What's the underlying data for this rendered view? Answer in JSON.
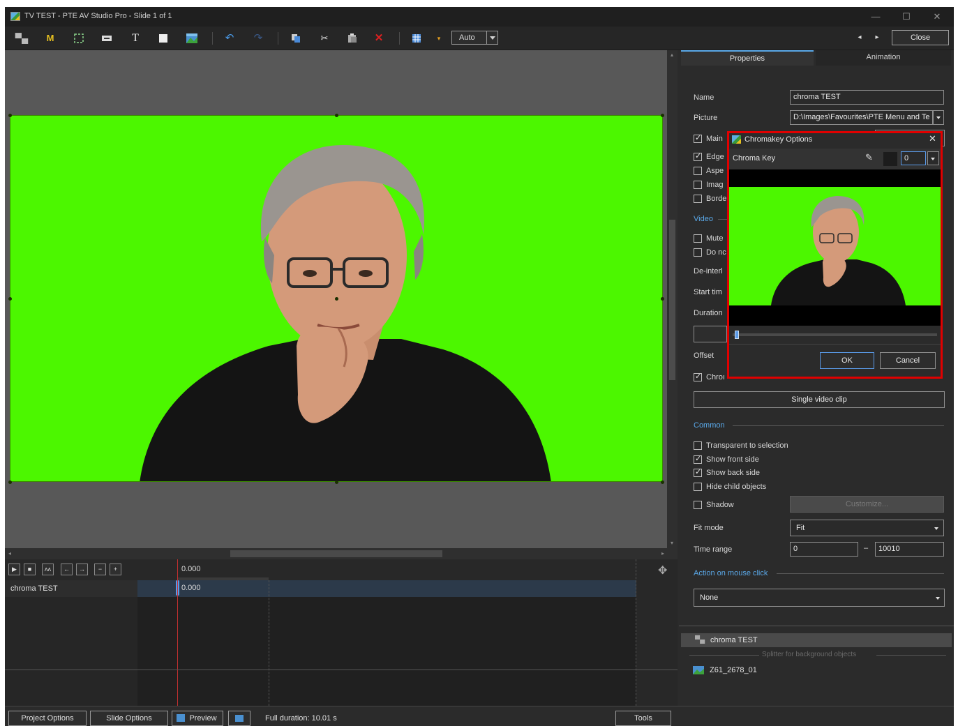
{
  "window": {
    "title": "TV TEST - PTE AV Studio Pro - Slide 1 of 1"
  },
  "toolbar": {
    "zoom_value": "Auto",
    "close_label": "Close",
    "icons": [
      "video-icon",
      "mask-icon",
      "frame-icon",
      "button-icon",
      "text-icon",
      "rectangle-icon",
      "image-icon",
      "undo-icon",
      "redo-icon",
      "copy-icon",
      "cut-icon",
      "paste-icon",
      "delete-icon",
      "grid-icon",
      "grid-dropdown-icon"
    ]
  },
  "timeline": {
    "position": "0.000",
    "object_name": "chroma TEST",
    "clip_start": "0.000",
    "buttons": [
      "▶",
      "■",
      "ʌʌ",
      "←",
      "→",
      "−",
      "+"
    ]
  },
  "panel": {
    "tabs": [
      "Properties",
      "Animation"
    ],
    "name_label": "Name",
    "name_value": "chroma TEST",
    "picture_label": "Picture",
    "picture_value": "D:\\Images\\Favourites\\PTE Menu and Te",
    "main_label": "Main",
    "edge_label": "Edge",
    "aspect_label": "Aspe",
    "image_label": "Imag",
    "border_label": "Borde",
    "video_section": "Video",
    "mute_label": "Mute",
    "donot_label": "Do nc",
    "deinterlace_label": "De-interl",
    "start_time_label": "Start tim",
    "duration_label": "Duration",
    "offset_label": "Offset",
    "chroma_label": "Chroı",
    "single_clip_button": "Single video clip",
    "common_section": "Common",
    "transparent_label": "Transparent to selection",
    "show_front_label": "Show front side",
    "show_back_label": "Show back side",
    "hide_child_label": "Hide child objects",
    "shadow_label": "Shadow",
    "customize_button": "Customize...",
    "fit_mode_label": "Fit mode",
    "fit_mode_value": "Fit",
    "time_range_label": "Time range",
    "time_range_from": "0",
    "time_range_dash": "–",
    "time_range_to": "10010",
    "action_section": "Action on mouse click",
    "action_value": "None",
    "object_list_item": "chroma TEST",
    "splitter_label": "Splitter for background objects",
    "background_item": "Z61_2678_01"
  },
  "dialog": {
    "title": "Chromakey Options",
    "chroma_key_label": "Chroma Key",
    "value": "0",
    "ok_label": "OK",
    "cancel_label": "Cancel",
    "slider_position": 0.01
  },
  "bottom": {
    "project_options": "Project Options",
    "slide_options": "Slide Options",
    "preview": "Preview",
    "full_duration": "Full duration: 10.01 s",
    "tools": "Tools"
  },
  "colors": {
    "chroma_green": "#4cf700",
    "accent_blue": "#5aa8e8",
    "highlight_red": "#e00000"
  }
}
